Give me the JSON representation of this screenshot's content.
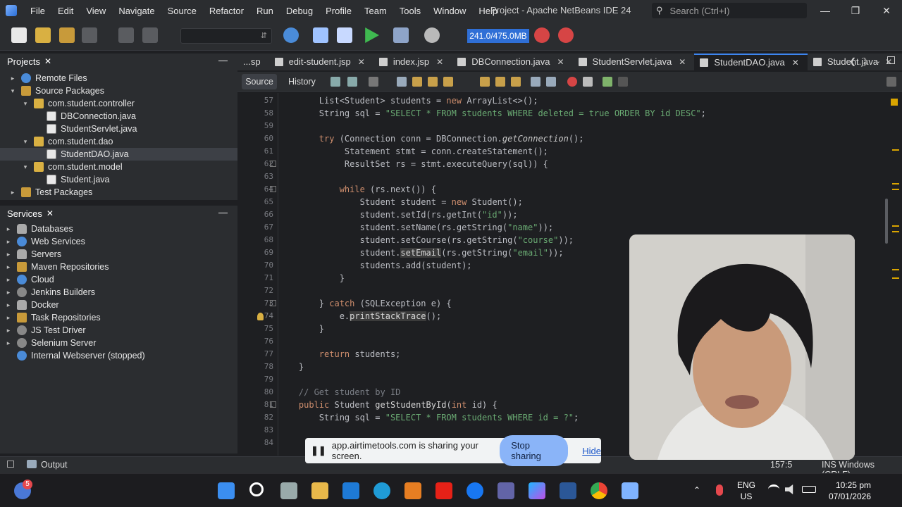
{
  "window": {
    "title": "Project - Apache NetBeans IDE 24",
    "search_placeholder": "Search (Ctrl+I)",
    "menu": [
      "File",
      "Edit",
      "View",
      "Navigate",
      "Source",
      "Refactor",
      "Run",
      "Debug",
      "Profile",
      "Team",
      "Tools",
      "Window",
      "Help"
    ]
  },
  "toolbar": {
    "memory": "241.0/475.0MB"
  },
  "projects": {
    "title": "Projects",
    "items": [
      {
        "label": "Remote Files",
        "depth": 1,
        "toggle": "▸",
        "icon": "globe"
      },
      {
        "label": "Source Packages",
        "depth": 1,
        "toggle": "▾",
        "icon": "fold"
      },
      {
        "label": "com.student.controller",
        "depth": 2,
        "toggle": "▾",
        "icon": "pkg"
      },
      {
        "label": "DBConnection.java",
        "depth": 3,
        "toggle": "",
        "icon": "file"
      },
      {
        "label": "StudentServlet.java",
        "depth": 3,
        "toggle": "",
        "icon": "file"
      },
      {
        "label": "com.student.dao",
        "depth": 2,
        "toggle": "▾",
        "icon": "pkg"
      },
      {
        "label": "StudentDAO.java",
        "depth": 3,
        "toggle": "",
        "icon": "file",
        "selected": true
      },
      {
        "label": "com.student.model",
        "depth": 2,
        "toggle": "▾",
        "icon": "pkg"
      },
      {
        "label": "Student.java",
        "depth": 3,
        "toggle": "",
        "icon": "file"
      },
      {
        "label": "Test Packages",
        "depth": 1,
        "toggle": "▸",
        "icon": "fold"
      }
    ]
  },
  "services": {
    "title": "Services",
    "items": [
      {
        "label": "Databases",
        "icon": "db"
      },
      {
        "label": "Web Services",
        "icon": "globe"
      },
      {
        "label": "Servers",
        "icon": "db"
      },
      {
        "label": "Maven Repositories",
        "icon": "fold"
      },
      {
        "label": "Cloud",
        "icon": "globe"
      },
      {
        "label": "Jenkins Builders",
        "icon": "gear"
      },
      {
        "label": "Docker",
        "icon": "db"
      },
      {
        "label": "Task Repositories",
        "icon": "fold"
      },
      {
        "label": "JS Test Driver",
        "icon": "gear"
      },
      {
        "label": "Selenium Server",
        "icon": "gear"
      },
      {
        "label": "Internal Webserver (stopped)",
        "icon": "globe",
        "noToggle": true
      }
    ]
  },
  "tabs": [
    {
      "label": "...sp",
      "closable": false
    },
    {
      "label": "edit-student.jsp",
      "closable": true
    },
    {
      "label": "index.jsp",
      "closable": true
    },
    {
      "label": "DBConnection.java",
      "closable": true
    },
    {
      "label": "StudentServlet.java",
      "closable": true
    },
    {
      "label": "StudentDAO.java",
      "closable": true,
      "active": true
    },
    {
      "label": "Student.java",
      "closable": true
    }
  ],
  "editor_toolbar": {
    "source": "Source",
    "history": "History"
  },
  "code": {
    "lines": [
      "57",
      "58",
      "59",
      "60",
      "61",
      "62",
      "63",
      "64",
      "65",
      "66",
      "67",
      "68",
      "69",
      "70",
      "71",
      "72",
      "73",
      "74",
      "75",
      "76",
      "77",
      "78",
      "79",
      "80",
      "81",
      "82",
      "83",
      "84"
    ]
  },
  "status": {
    "output": "Output",
    "position": "157:5",
    "mode": "INS Windows (CRLF)"
  },
  "share_bar": {
    "text": "app.airtimetools.com is sharing your screen.",
    "stop": "Stop sharing",
    "hide": "Hide"
  },
  "taskbar": {
    "lang": "ENG",
    "region": "US",
    "time": "10:25 pm",
    "date": "07/01/2026",
    "badge": "5"
  }
}
